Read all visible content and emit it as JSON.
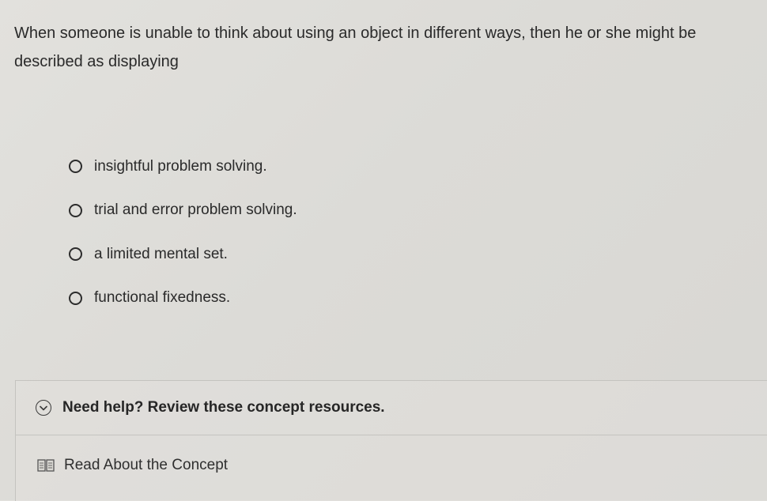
{
  "question": {
    "text": "When someone is unable to think about using an object in different ways, then he or she might be described as displaying"
  },
  "options": [
    {
      "label": "insightful problem solving.",
      "selected": false
    },
    {
      "label": "trial and error problem solving.",
      "selected": false
    },
    {
      "label": "a limited mental set.",
      "selected": false
    },
    {
      "label": "functional fixedness.",
      "selected": false
    }
  ],
  "help": {
    "title": "Need help? Review these concept resources.",
    "icon": "chevron-down-circle-icon",
    "resources": [
      {
        "label": "Read About the Concept",
        "icon": "book-icon"
      }
    ]
  }
}
